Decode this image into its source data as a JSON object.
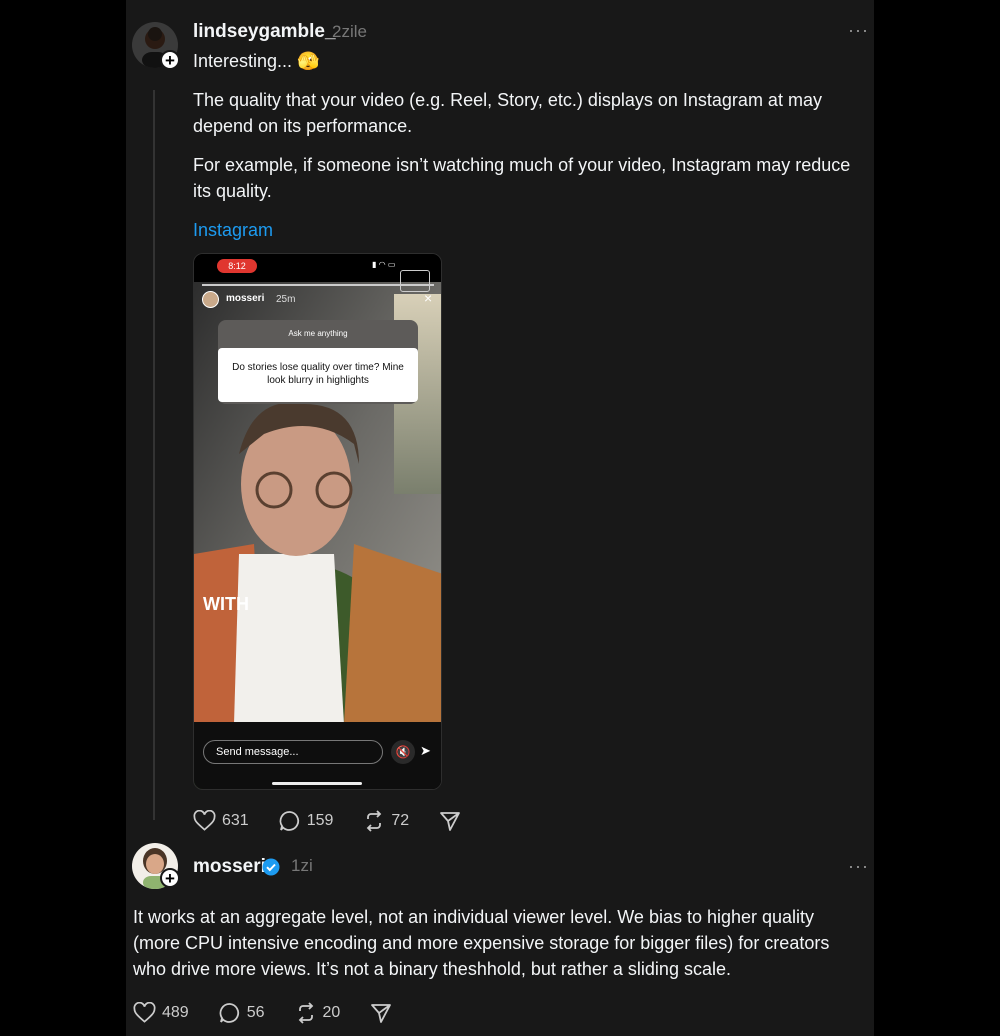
{
  "post1": {
    "username": "lindseygamble_",
    "time": "2zile",
    "headline": "Interesting... 🫣",
    "paragraph1": "The quality that your video (e.g. Reel, Story, etc.) displays on Instagram at may depend on its performance.",
    "paragraph2": "For example, if someone isn’t watching much of your video, Instagram may reduce its quality.",
    "link": "Instagram",
    "likes": "631",
    "comments": "159",
    "reposts": "72",
    "more": "···"
  },
  "story": {
    "status_time": "8:12",
    "user": "mosseri",
    "age": "25m",
    "ask_label": "Ask me anything",
    "question": "Do stories lose quality over time? Mine look blurry in highlights",
    "caption": "WITH",
    "message_placeholder": "Send message..."
  },
  "post2": {
    "username": "mosseri",
    "time": "1zi",
    "text": "It works at an aggregate level, not an individual viewer level. We bias to higher quality (more CPU intensive encoding and more expensive storage for bigger files) for creators who drive more views. It’s not a binary theshhold, but rather a sliding scale.",
    "likes": "489",
    "comments": "56",
    "reposts": "20",
    "more": "···"
  },
  "icons": {
    "like": "heart-icon",
    "comment": "comment-icon",
    "repost": "repost-icon",
    "share": "share-icon",
    "verified": "verified-badge-icon",
    "follow": "plus-icon"
  },
  "colors": {
    "background": "#000000",
    "panel": "#181818",
    "link": "#1d9bf0",
    "verified": "#1d9bf0",
    "recording": "#e0362f"
  }
}
